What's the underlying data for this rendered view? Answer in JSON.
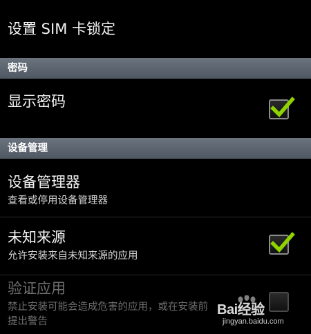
{
  "sim_lock": {
    "title": "设置 SIM 卡锁定"
  },
  "section_password": {
    "header": "密码",
    "show_password": {
      "title": "显示密码",
      "checked": true
    }
  },
  "section_device_admin": {
    "header": "设备管理",
    "device_administrators": {
      "title": "设备管理器",
      "summary": "查看或停用设备管理器"
    },
    "unknown_sources": {
      "title": "未知来源",
      "summary": "允许安装来自未知来源的应用",
      "checked": true
    },
    "verify_apps": {
      "title": "验证应用",
      "summary_line1": "禁止安装可能会造成危害的应用，或在安装前",
      "summary_line2": "提出警告",
      "checked": false,
      "enabled": false
    }
  },
  "watermark": {
    "brand": "Bai经验",
    "url": "jingyan.baidu.com"
  },
  "colors": {
    "background": "#000000",
    "header": "#5c6570",
    "check_green": "#8fd400",
    "text_primary": "#f2f2f2",
    "text_secondary": "#d6d6d6",
    "text_disabled": "#6e6e6e"
  }
}
